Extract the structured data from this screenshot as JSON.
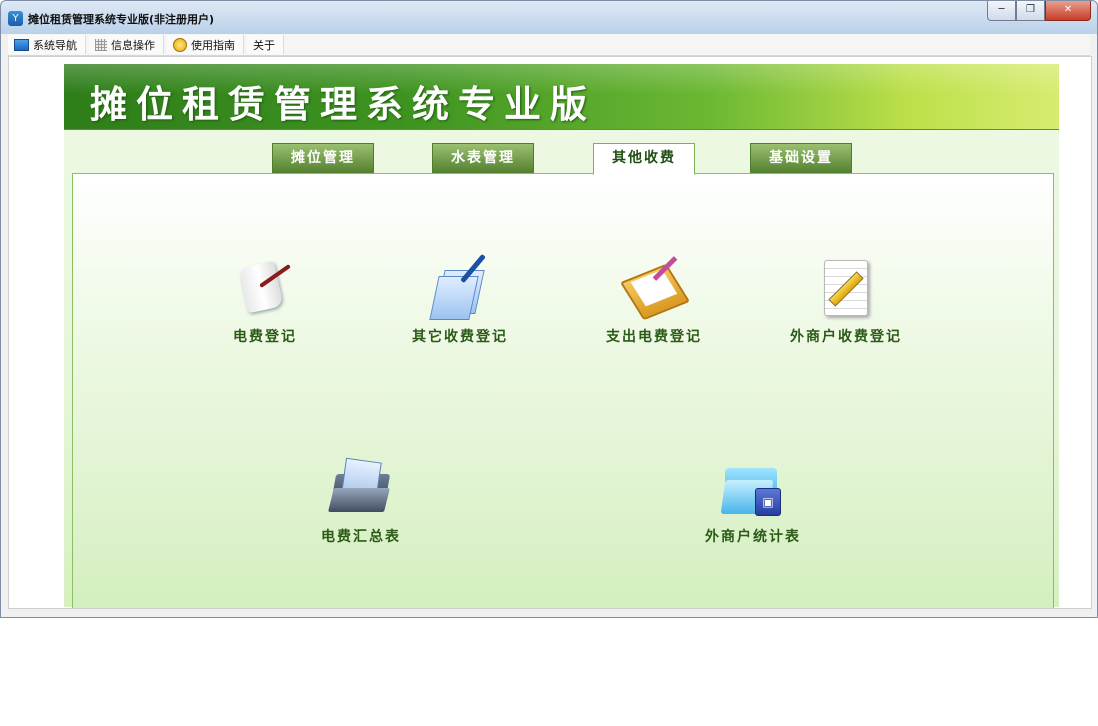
{
  "window": {
    "title": "摊位租赁管理系统专业版(非注册用户)",
    "controls": {
      "minimize": "─",
      "restore": "❐",
      "close": "✕"
    }
  },
  "menu": {
    "items": [
      {
        "label": "系统导航",
        "icon": "monitor-icon"
      },
      {
        "label": "信息操作",
        "icon": "grid-icon"
      },
      {
        "label": "使用指南",
        "icon": "help-icon"
      },
      {
        "label": "关于",
        "icon": ""
      }
    ]
  },
  "banner": {
    "title": "摊位租赁管理系统专业版"
  },
  "tabs": [
    {
      "label": "摊位管理",
      "active": false
    },
    {
      "label": "水表管理",
      "active": false
    },
    {
      "label": "其他收费",
      "active": true
    },
    {
      "label": "基础设置",
      "active": false
    }
  ],
  "functions": [
    {
      "label": "电费登记",
      "icon": "scroll-pen-icon"
    },
    {
      "label": "其它收费登记",
      "icon": "documents-pen-icon"
    },
    {
      "label": "支出电费登记",
      "icon": "clipboard-icon"
    },
    {
      "label": "外商户收费登记",
      "icon": "notepad-pencil-icon"
    },
    {
      "label": "电费汇总表",
      "icon": "folder-documents-icon"
    },
    {
      "label": "外商户统计表",
      "icon": "folder-badge-icon"
    }
  ],
  "colors": {
    "banner_dark": "#2e7d1a",
    "banner_light": "#d6ec70",
    "label_text": "#2a5a16",
    "tab_bg": "#527f2e"
  }
}
